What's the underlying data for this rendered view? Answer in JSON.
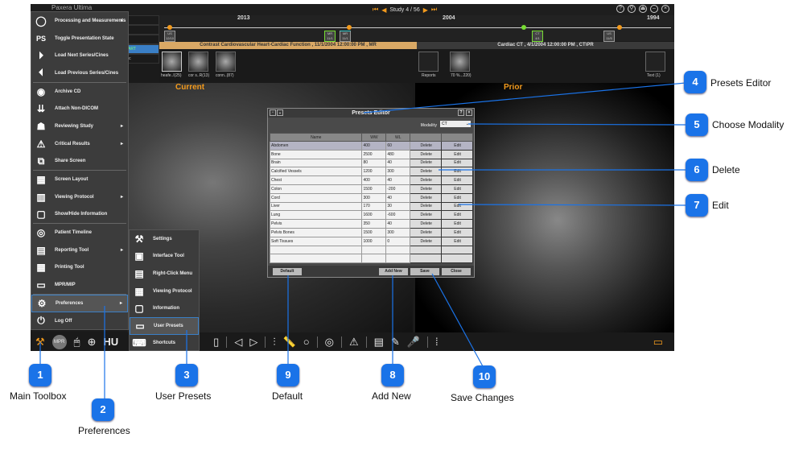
{
  "app": {
    "title": "Paxera Ultima",
    "study_nav": "Study 4 / 56"
  },
  "timeline": {
    "years": [
      "2013",
      "2004",
      "1994"
    ],
    "chips": [
      {
        "mod": "US",
        "date": "12/10"
      },
      {
        "mod": "MR",
        "date": "11/1"
      },
      {
        "mod": "MR",
        "date": "11/1"
      },
      {
        "mod": "CT",
        "date": "4/1"
      },
      {
        "mod": "US",
        "date": "11/5"
      }
    ]
  },
  "left_panel": {
    "items": [
      "",
      "",
      "",
      "ART",
      "ic"
    ]
  },
  "studies": {
    "current": "Contrast Cardiovascular Heart-Cardiac Function , 11/1/2004 12:00:00 PM , MR",
    "prior": "Cardiac CT , 4/1/2004 12:00:00 PM , CT\\PR"
  },
  "thumbnails": {
    "current": [
      "heafe..I(25)",
      "cor s..R(13)",
      "conn..(87)",
      "Reports"
    ],
    "prior": [
      "70 %...220)",
      "Text (1)"
    ]
  },
  "viewports": {
    "current": "Current",
    "prior": "Prior"
  },
  "main_menu": {
    "items": [
      {
        "label": "Processing and Measurements",
        "icon": "circle-icon",
        "sub": true
      },
      {
        "label": "Toggle Presentation State",
        "icon": "ps-icon"
      },
      {
        "label": "Load Next Series/Cines",
        "icon": "play-icon"
      },
      {
        "label": "Load Previous Series/Cines",
        "icon": "play-back-icon"
      },
      {
        "label": "Archive CD",
        "icon": "cd-icon"
      },
      {
        "label": "Attach Non-DICOM",
        "icon": "attach-icon"
      },
      {
        "label": "Reviewing Study",
        "icon": "review-icon",
        "sub": true
      },
      {
        "label": "Critical Results",
        "icon": "warning-icon",
        "sub": true
      },
      {
        "label": "Share Screen",
        "icon": "share-icon"
      },
      {
        "label": "Screen Layout",
        "icon": "layout-icon"
      },
      {
        "label": "Viewing Protocol",
        "icon": "protocol-icon",
        "sub": true
      },
      {
        "label": "Show/Hide Information",
        "icon": "info-icon"
      },
      {
        "label": "Patient Timeline",
        "icon": "timeline-icon"
      },
      {
        "label": "Reporting Tool",
        "icon": "report-icon",
        "sub": true
      },
      {
        "label": "Printing Tool",
        "icon": "print-icon"
      },
      {
        "label": "MPR/MIP",
        "icon": "mpr-icon"
      },
      {
        "label": "Preferences",
        "icon": "gear-icon",
        "sub": true,
        "selected": true
      },
      {
        "label": "Log Off",
        "icon": "power-icon"
      }
    ]
  },
  "sub_menu": {
    "items": [
      "Settings",
      "Interface Tool",
      "Right-Click Menu",
      "Viewing Protocol",
      "Information",
      "User Presets",
      "Shortcuts"
    ],
    "selected": "User Presets"
  },
  "toolbar": {
    "mpr": "MPR",
    "hu": "HU"
  },
  "presets_editor": {
    "title": "Presets Editor",
    "modality_label": "Modality",
    "modality": "CT",
    "columns": [
      "Name",
      "WW",
      "WL",
      "",
      ""
    ],
    "rows": [
      {
        "name": "Abdomen",
        "ww": "400",
        "wl": "60"
      },
      {
        "name": "Bone",
        "ww": "2500",
        "wl": "480"
      },
      {
        "name": "Brain",
        "ww": "80",
        "wl": "40"
      },
      {
        "name": "Calcified Vessels",
        "ww": "1200",
        "wl": "300"
      },
      {
        "name": "Chest",
        "ww": "400",
        "wl": "40"
      },
      {
        "name": "Colon",
        "ww": "1500",
        "wl": "-200"
      },
      {
        "name": "Cord",
        "ww": "300",
        "wl": "40"
      },
      {
        "name": "Liver",
        "ww": "170",
        "wl": "30"
      },
      {
        "name": "Lung",
        "ww": "1600",
        "wl": "-600"
      },
      {
        "name": "Pelvis",
        "ww": "350",
        "wl": "40"
      },
      {
        "name": "Pelvis Bones",
        "ww": "1500",
        "wl": "300"
      },
      {
        "name": "Soft Tissues",
        "ww": "1000",
        "wl": "0"
      }
    ],
    "delete_label": "Delete",
    "edit_label": "Edit",
    "buttons": {
      "default": "Default",
      "add_new": "Add New",
      "save": "Save",
      "close": "Close"
    }
  },
  "callouts": [
    {
      "n": "1",
      "label": "Main Toolbox"
    },
    {
      "n": "2",
      "label": "Preferences"
    },
    {
      "n": "3",
      "label": "User Presets"
    },
    {
      "n": "4",
      "label": "Presets Editor"
    },
    {
      "n": "5",
      "label": "Choose Modality"
    },
    {
      "n": "6",
      "label": "Delete"
    },
    {
      "n": "7",
      "label": "Edit"
    },
    {
      "n": "8",
      "label": "Add New"
    },
    {
      "n": "9",
      "label": "Default"
    },
    {
      "n": "10",
      "label": "Save Changes"
    }
  ],
  "colors": {
    "accent": "#f29a1d",
    "callout": "#1a73e8",
    "current_bar": "#d9a865",
    "prior_bar": "#3a3a3a"
  }
}
